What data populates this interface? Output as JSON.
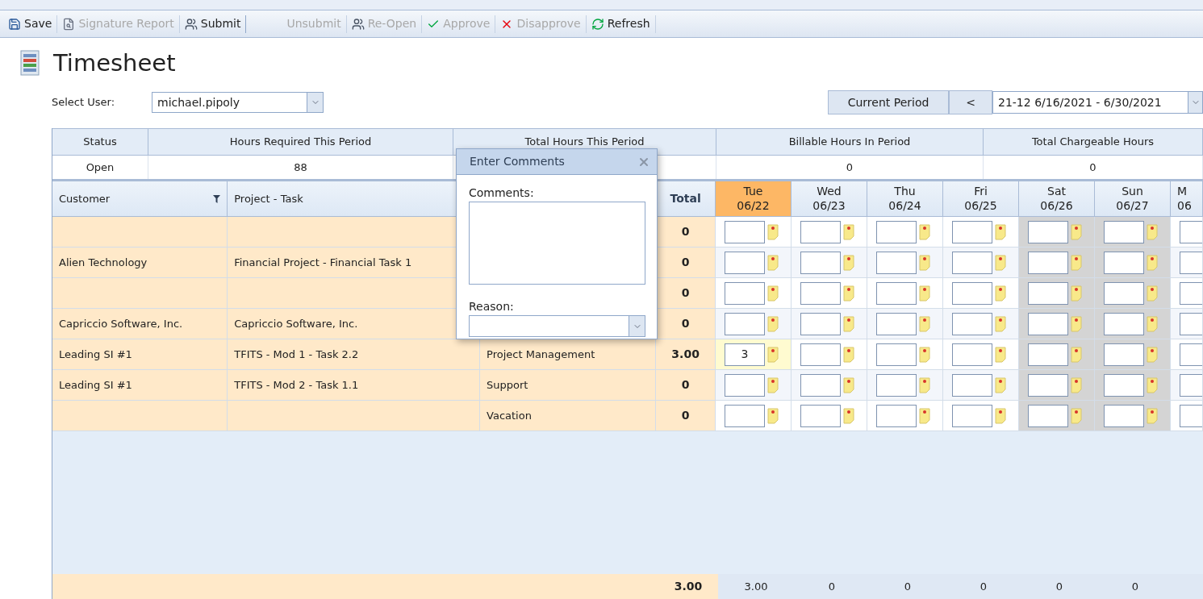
{
  "toolbar": [
    {
      "label": "Save",
      "kind": "save",
      "disabled": false
    },
    {
      "label": "Signature Report",
      "kind": "report",
      "disabled": true
    },
    {
      "label": "Submit",
      "kind": "submit",
      "disabled": false
    },
    {
      "label": "Unsubmit",
      "kind": "unsubmit",
      "disabled": true
    },
    {
      "label": "Re-Open",
      "kind": "reopen",
      "disabled": true
    },
    {
      "label": "Approve",
      "kind": "approve",
      "disabled": true
    },
    {
      "label": "Disapprove",
      "kind": "disapprove",
      "disabled": true
    },
    {
      "label": "Refresh",
      "kind": "refresh",
      "disabled": false
    }
  ],
  "title": "Timesheet",
  "user": {
    "label": "Select User:",
    "value": "michael.pipoly"
  },
  "period": {
    "current_button": "Current Period",
    "prev_button": "<",
    "value": "21-12 6/16/2021 - 6/30/2021"
  },
  "summary": {
    "columns": [
      {
        "label": "Status",
        "value": "Open"
      },
      {
        "label": "Hours Required This Period",
        "value": "88"
      },
      {
        "label": "Total Hours This Period"
      },
      {
        "label": "Billable Hours In Period",
        "value": "0"
      },
      {
        "label": "Total Chargeable Hours",
        "value": "0"
      }
    ]
  },
  "grid": {
    "columns": {
      "customer": "Customer",
      "project": "Project - Task",
      "total": "Total"
    },
    "days": [
      {
        "day": "Tue",
        "date": "06/22",
        "selected": true,
        "weekend": false
      },
      {
        "day": "Wed",
        "date": "06/23",
        "selected": false,
        "weekend": false
      },
      {
        "day": "Thu",
        "date": "06/24",
        "selected": false,
        "weekend": false
      },
      {
        "day": "Fri",
        "date": "06/25",
        "selected": false,
        "weekend": false
      },
      {
        "day": "Sat",
        "date": "06/26",
        "selected": false,
        "weekend": true
      },
      {
        "day": "Sun",
        "date": "06/27",
        "selected": false,
        "weekend": true
      },
      {
        "day": "M",
        "date": "06",
        "selected": false,
        "weekend": false
      }
    ],
    "rows": [
      {
        "total": "0"
      },
      {
        "customer": "Alien Technology",
        "project": "Financial Project - Financial Task 1",
        "total": "0"
      },
      {
        "total": "0"
      },
      {
        "customer": "Capriccio Software, Inc.",
        "project": "Capriccio Software, Inc.",
        "total": "0"
      },
      {
        "customer": "Leading SI #1",
        "project": "TFITS - Mod 1 - Task 2.2",
        "task": "Project Management",
        "total": "3.00",
        "hours": [
          "3"
        ]
      },
      {
        "customer": "Leading SI #1",
        "project": "TFITS - Mod 2 - Task 1.1",
        "task": "Support",
        "total": "0"
      },
      {
        "task": "Vacation",
        "total": "0"
      }
    ],
    "footer": {
      "total": "3.00",
      "days": [
        "3.00",
        "0",
        "0",
        "0",
        "0",
        "0"
      ]
    }
  },
  "dialog": {
    "title": "Enter Comments",
    "comments_label": "Comments:",
    "reason_label": "Reason:"
  }
}
